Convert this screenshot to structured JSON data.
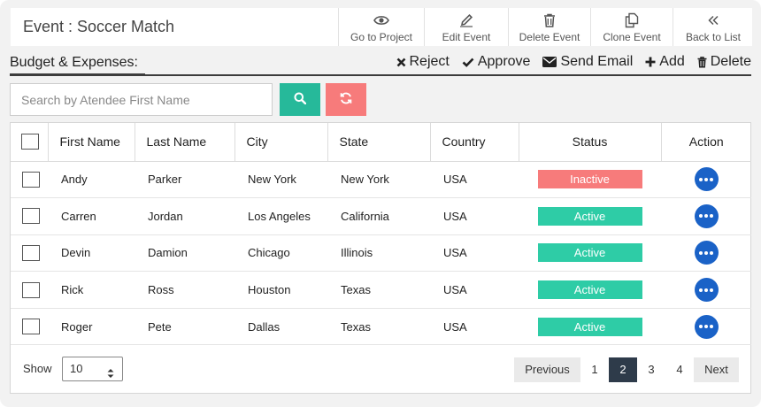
{
  "header": {
    "title": "Event : Soccer Match",
    "tools": [
      {
        "label": "Go to Project",
        "icon": "eye-icon"
      },
      {
        "label": "Edit Event",
        "icon": "pencil-icon"
      },
      {
        "label": "Delete Event",
        "icon": "trash-icon"
      },
      {
        "label": "Clone Event",
        "icon": "clone-icon"
      },
      {
        "label": "Back to List",
        "icon": "double-chevron-left-icon"
      }
    ]
  },
  "section": {
    "title": "Budget & Expenses:",
    "actions": [
      {
        "label": "Reject",
        "icon": "x-icon"
      },
      {
        "label": "Approve",
        "icon": "check-icon"
      },
      {
        "label": "Send Email",
        "icon": "envelope-icon"
      },
      {
        "label": "Add",
        "icon": "plus-icon"
      },
      {
        "label": "Delete",
        "icon": "trash-icon"
      }
    ]
  },
  "search": {
    "placeholder": "Search by Atendee First Name",
    "value": ""
  },
  "colors": {
    "search_button": "#26b99a",
    "refresh_button": "#f77b7b",
    "active": "#2ecca6",
    "inactive": "#f77b7b",
    "action_button": "#1a62c7",
    "current_page": "#2e3b4a"
  },
  "table": {
    "columns": [
      "First Name",
      "Last Name",
      "City",
      "State",
      "Country",
      "Status",
      "Action"
    ],
    "rows": [
      {
        "first": "Andy",
        "last": "Parker",
        "city": "New York",
        "state": "New York",
        "country": "USA",
        "status": "Inactive"
      },
      {
        "first": "Carren",
        "last": "Jordan",
        "city": "Los Angeles",
        "state": "California",
        "country": "USA",
        "status": "Active"
      },
      {
        "first": "Devin",
        "last": "Damion",
        "city": "Chicago",
        "state": "Illinois",
        "country": "USA",
        "status": "Active"
      },
      {
        "first": "Rick",
        "last": "Ross",
        "city": "Houston",
        "state": "Texas",
        "country": "USA",
        "status": "Active"
      },
      {
        "first": "Roger",
        "last": "Pete",
        "city": "Dallas",
        "state": "Texas",
        "country": "USA",
        "status": "Active"
      }
    ]
  },
  "footer": {
    "show_label": "Show",
    "page_size": "10",
    "previous": "Previous",
    "next": "Next",
    "pages": [
      "1",
      "2",
      "3",
      "4"
    ],
    "current_page": "2"
  }
}
